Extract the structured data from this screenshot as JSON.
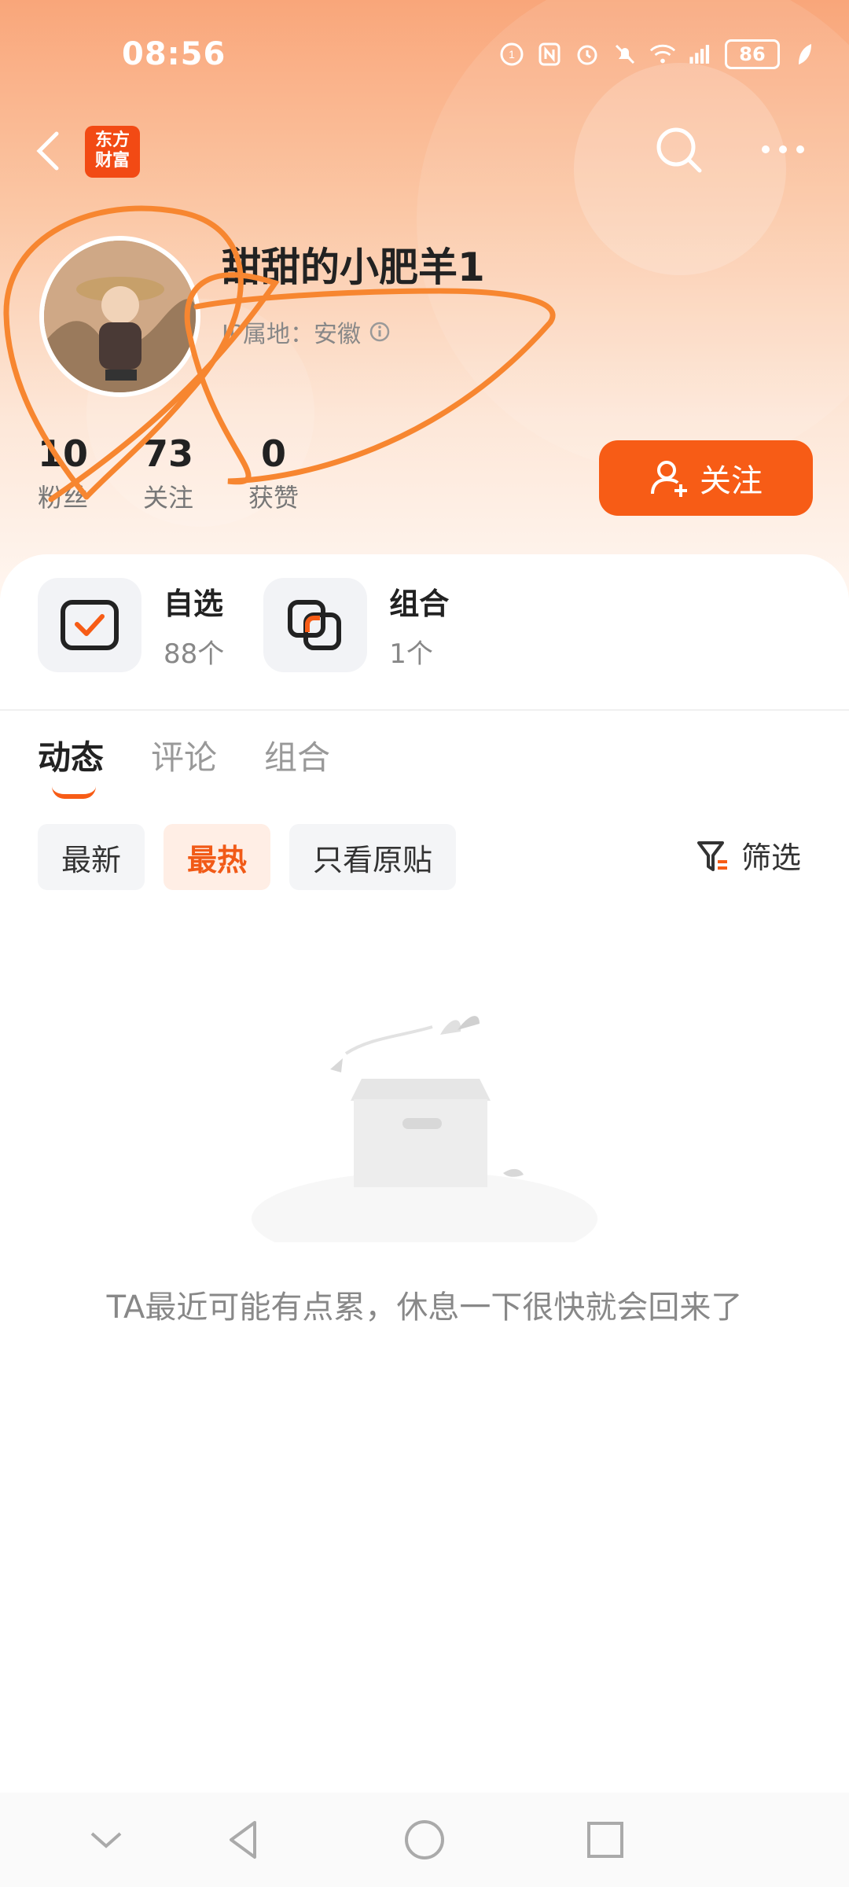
{
  "status_bar": {
    "time": "08:56",
    "battery": "86"
  },
  "nav": {
    "app_badge_line1": "东方",
    "app_badge_line2": "财富"
  },
  "profile": {
    "username": "甜甜的小肥羊1",
    "ip_location": "IP属地：安徽",
    "stats": [
      {
        "value": "10",
        "label": "粉丝"
      },
      {
        "value": "73",
        "label": "关注"
      },
      {
        "value": "0",
        "label": "获赞"
      }
    ],
    "follow_label": "关注"
  },
  "quick_links": [
    {
      "title": "自选",
      "subtitle": "88个"
    },
    {
      "title": "组合",
      "subtitle": "1个"
    }
  ],
  "tabs": [
    "动态",
    "评论",
    "组合"
  ],
  "filters": {
    "chips": [
      "最新",
      "最热",
      "只看原贴"
    ],
    "active": "最热",
    "filter_label": "筛选"
  },
  "empty_state": {
    "message": "TA最近可能有点累，休息一下很快就会回来了"
  },
  "colors": {
    "accent": "#f75c16",
    "header_top": "#f9a67a"
  }
}
